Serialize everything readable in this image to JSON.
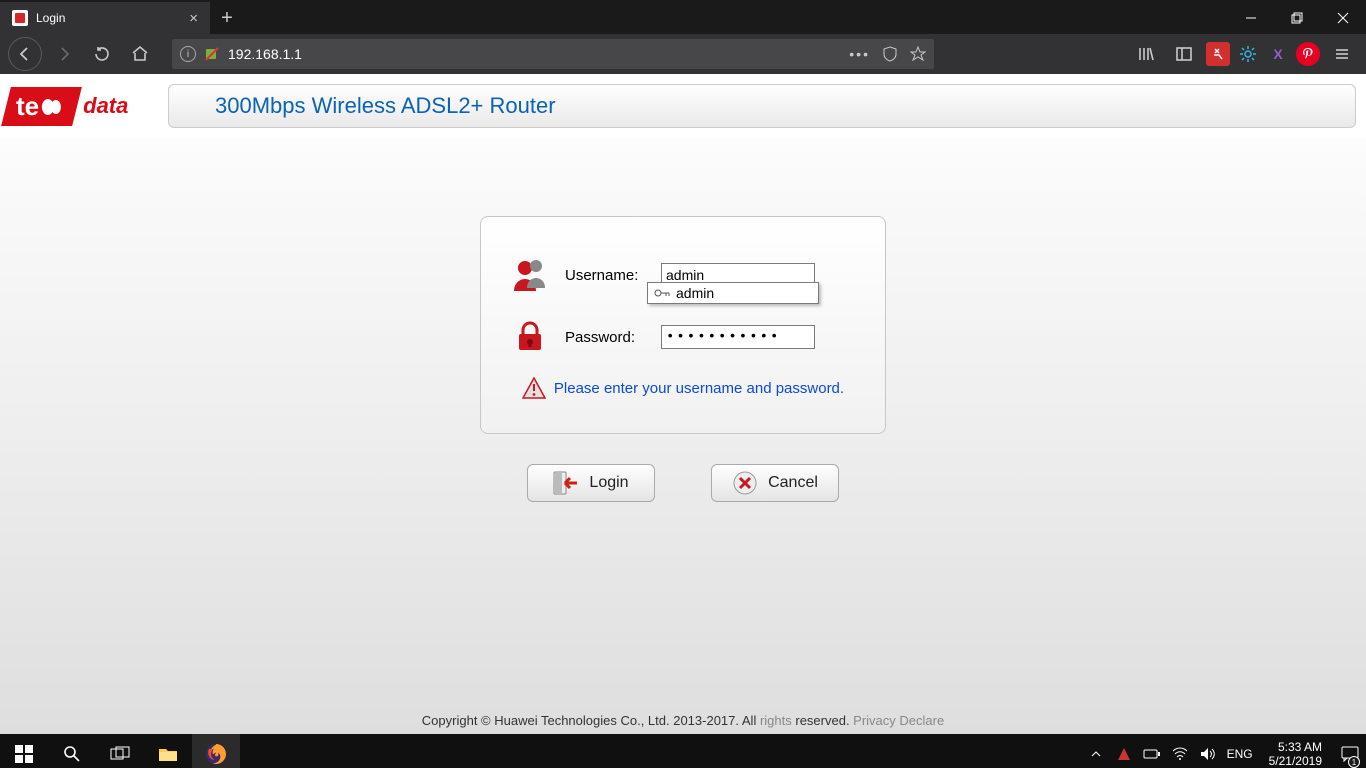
{
  "browser": {
    "tab_title": "Login",
    "url": "192.168.1.1"
  },
  "page": {
    "logo_prefix": "te",
    "logo_suffix": "data",
    "product_title": "300Mbps Wireless ADSL2+ Router"
  },
  "login": {
    "username_label": "Username:",
    "username_value": "admin",
    "autocomplete_option": "admin",
    "password_label": "Password:",
    "password_value": "•••••••••••",
    "hint": "Please enter your username and password.",
    "login_btn": "Login",
    "cancel_btn": "Cancel"
  },
  "footer": {
    "copyright_a": "Copyright © Huawei Technologies Co., Ltd. 2013-2017. All ",
    "copyright_b": "rights",
    "copyright_c": " reserved. ",
    "privacy": "Privacy Declare"
  },
  "taskbar": {
    "lang": "ENG",
    "time": "5:33 AM",
    "date": "5/21/2019",
    "notif_count": "1"
  }
}
